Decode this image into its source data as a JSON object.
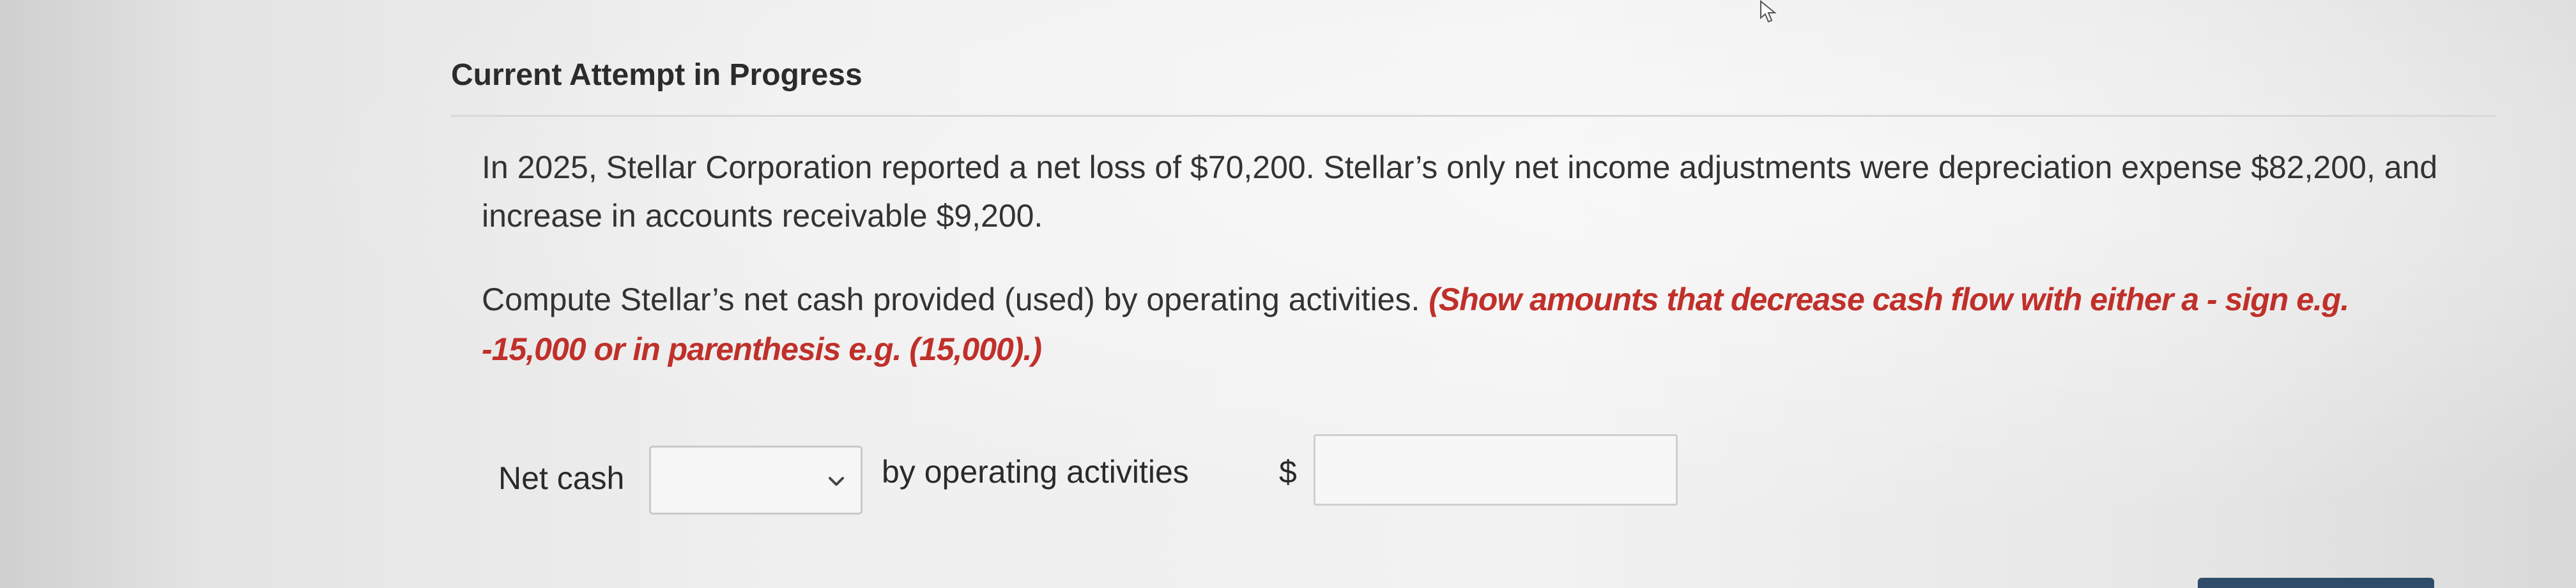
{
  "header": {
    "title": "Current Attempt in Progress"
  },
  "question": {
    "text": "In 2025, Stellar Corporation reported a net loss of $70,200. Stellar’s only net income adjustments were depreciation expense $82,200, and increase in accounts receivable $9,200."
  },
  "instruction": {
    "text": "Compute Stellar’s net cash provided (used) by operating activities. ",
    "hint": "(Show amounts that decrease cash flow with either a - sign e.g. -15,000 or in parenthesis e.g. (15,000).)"
  },
  "answer": {
    "net_cash_label": "Net cash",
    "select_value": "",
    "by_label": "by operating activities",
    "currency": "$",
    "amount_value": ""
  },
  "icons": {
    "chevron": "chevron-down-icon",
    "cursor": "mouse-cursor-icon"
  },
  "colors": {
    "hint": "#c0302a",
    "text": "#333333"
  }
}
